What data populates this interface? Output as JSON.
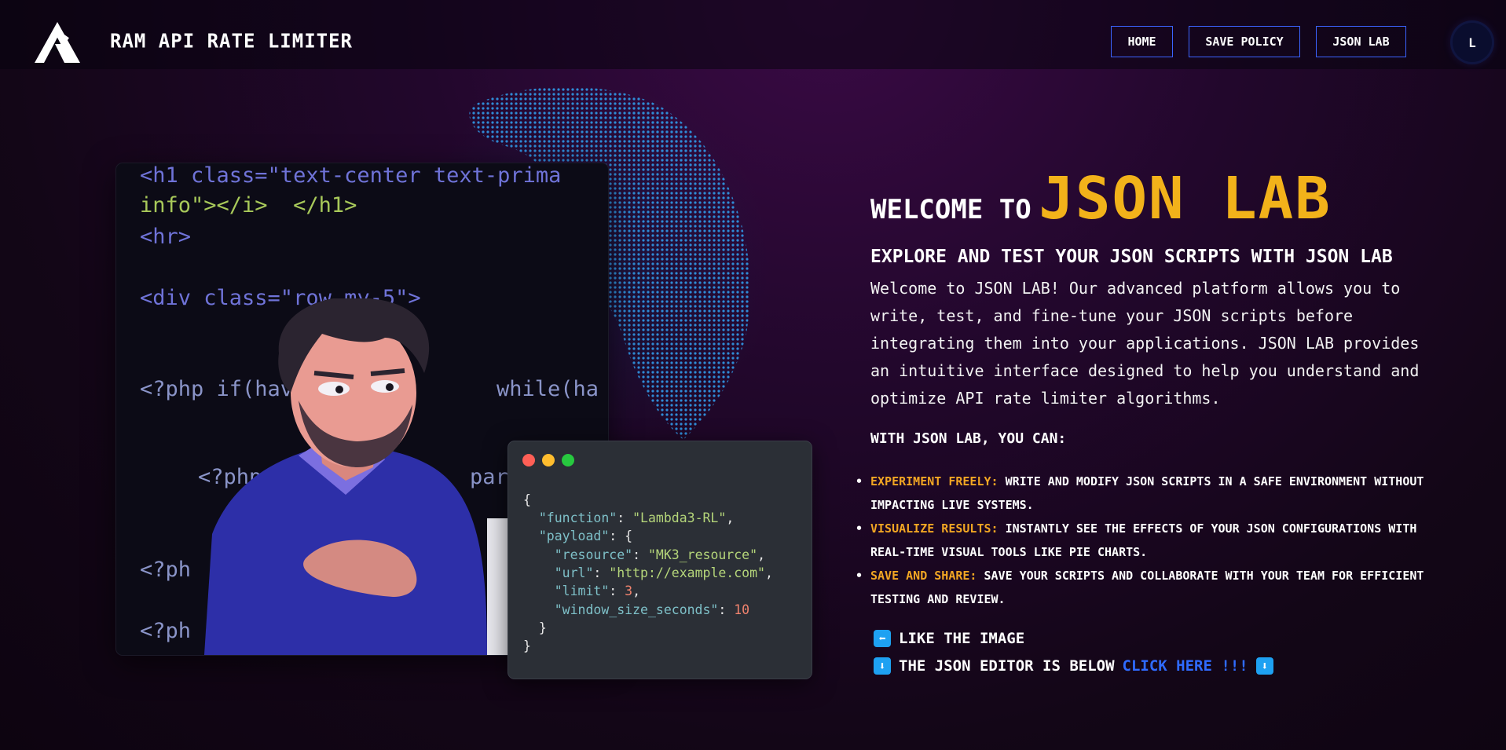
{
  "navbar": {
    "brand": "RAM API RATE LIMITER",
    "links": [
      {
        "label": "HOME"
      },
      {
        "label": "SAVE POLICY"
      },
      {
        "label": "JSON LAB"
      }
    ],
    "avatar_initial": "L"
  },
  "hero_code": {
    "lines": [
      "<h1 class=\"text-center text-prima",
      "info\"></i>  </h1>",
      "<hr>",
      "<div class=\"row my-5\">",
      "<?php if(have",
      "while(ha",
      "<?php",
      "par",
      "<?ph",
      "<?ph"
    ]
  },
  "json_sample": {
    "function": "Lambda3-RL",
    "resource": "MK3_resource",
    "url": "http://example.com",
    "limit": "3",
    "window_size_seconds": "10"
  },
  "content": {
    "welcome_prefix": "WELCOME TO",
    "welcome_accent": "JSON LAB",
    "subtitle": "EXPLORE AND TEST YOUR JSON SCRIPTS WITH JSON LAB",
    "intro": "Welcome to JSON LAB! Our advanced platform allows you to write, test, and fine-tune your JSON scripts before integrating them into your applications. JSON LAB provides an intuitive interface designed to help you understand and optimize API rate limiter algorithms.",
    "can_heading": "WITH JSON LAB, YOU CAN:",
    "features": [
      {
        "label": "EXPERIMENT FREELY:",
        "text": " WRITE AND MODIFY JSON SCRIPTS IN A SAFE ENVIRONMENT WITHOUT IMPACTING LIVE SYSTEMS."
      },
      {
        "label": "VISUALIZE RESULTS:",
        "text": " INSTANTLY SEE THE EFFECTS OF YOUR JSON CONFIGURATIONS WITH REAL-TIME VISUAL TOOLS LIKE PIE CHARTS."
      },
      {
        "label": "SAVE AND SHARE:",
        "text": " SAVE YOUR SCRIPTS AND COLLABORATE WITH YOUR TEAM FOR EFFICIENT TESTING AND REVIEW."
      }
    ],
    "cta_like": "LIKE THE IMAGE",
    "cta_editor": "THE JSON EDITOR IS BELOW",
    "cta_link": "CLICK HERE !!!",
    "icon_left": "⬅",
    "icon_down": "⬇"
  },
  "colors": {
    "accent_yellow": "#f2b21a",
    "nav_border": "#3b63ff",
    "link_blue": "#2f6bff",
    "emoji_blue": "#1ea1f2"
  },
  "icons": {
    "logo": "brand-logo-icon",
    "window_controls": [
      "close-dot-icon",
      "minimize-dot-icon",
      "maximize-dot-icon"
    ],
    "cta_like": "left-arrow-icon",
    "cta_down": "down-arrow-icon"
  }
}
